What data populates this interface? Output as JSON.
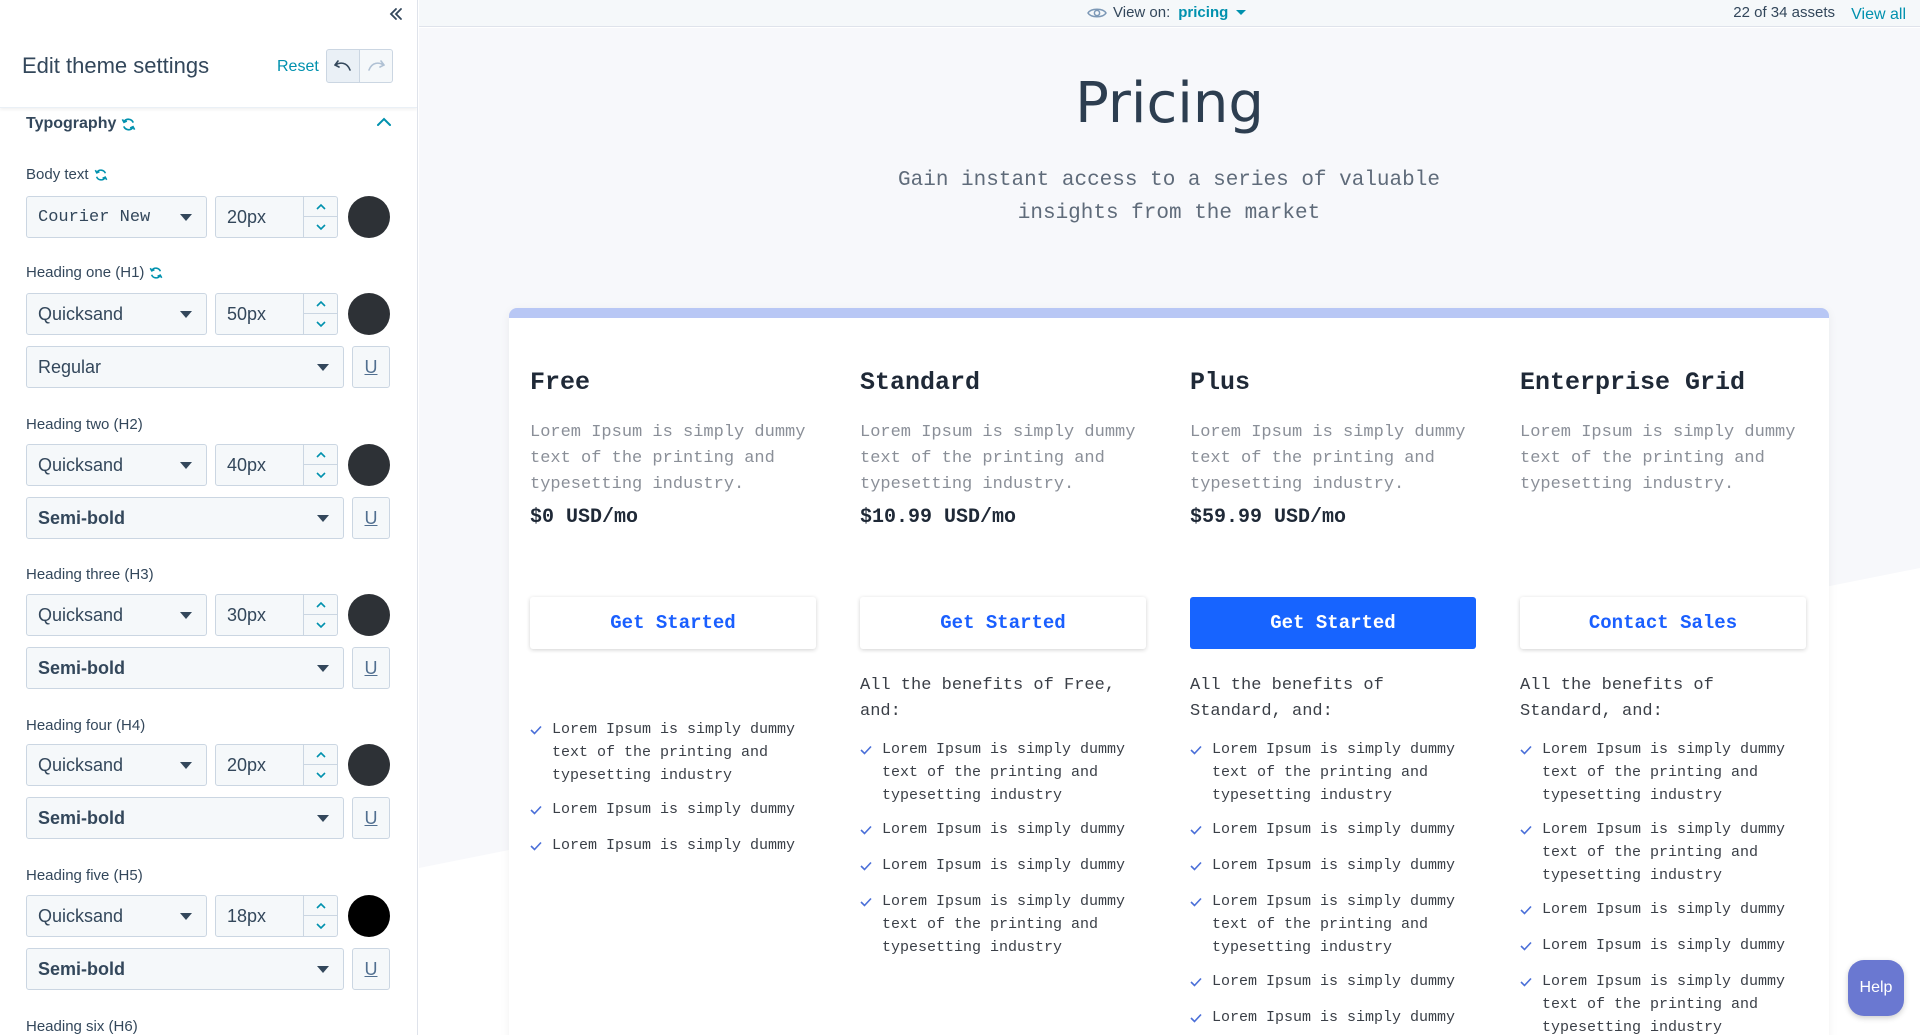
{
  "sidebar": {
    "title": "Edit theme settings",
    "reset_label": "Reset",
    "section": {
      "title": "Typography"
    },
    "groups": [
      {
        "label": "Body text",
        "sync": true,
        "font": "Courier New",
        "size": "20px",
        "color": "#2d3136"
      },
      {
        "label": "Heading one (H1)",
        "sync": true,
        "font": "Quicksand",
        "size": "50px",
        "color": "#2d3136",
        "weight": "Regular"
      },
      {
        "label": "Heading two (H2)",
        "sync": false,
        "font": "Quicksand",
        "size": "40px",
        "color": "#2d3136",
        "weight": "Semi-bold"
      },
      {
        "label": "Heading three (H3)",
        "sync": false,
        "font": "Quicksand",
        "size": "30px",
        "color": "#2d3136",
        "weight": "Semi-bold"
      },
      {
        "label": "Heading four (H4)",
        "sync": false,
        "font": "Quicksand",
        "size": "20px",
        "color": "#2d3136",
        "weight": "Semi-bold"
      },
      {
        "label": "Heading five (H5)",
        "sync": false,
        "font": "Quicksand",
        "size": "18px",
        "color": "#000000",
        "weight": "Semi-bold"
      },
      {
        "label": "Heading six (H6)"
      }
    ],
    "underline_glyph": "U"
  },
  "topbar": {
    "view_on_label": "View on:",
    "view_on_value": "pricing",
    "assets_count": "22 of 34 assets",
    "view_all": "View all"
  },
  "preview": {
    "title": "Pricing",
    "subtitle": "Gain instant access to a series of valuable insights from the market",
    "plans": [
      {
        "name": "Free",
        "description": "Lorem Ipsum is simply dummy text of the printing and typesetting industry.",
        "price": "$0 USD/mo",
        "cta": "Get Started",
        "primary": false,
        "intro": "",
        "features": [
          "Lorem Ipsum is simply dummy text of the printing and typesetting industry",
          "Lorem Ipsum is simply dummy",
          "Lorem Ipsum is simply dummy"
        ]
      },
      {
        "name": "Standard",
        "description": "Lorem Ipsum is simply dummy text of the printing and typesetting industry.",
        "price": "$10.99 USD/mo",
        "cta": "Get Started",
        "primary": false,
        "intro": "All the benefits of Free, and:",
        "features": [
          "Lorem Ipsum is simply dummy text of the printing and typesetting industry",
          "Lorem Ipsum is simply dummy",
          "Lorem Ipsum is simply dummy",
          "Lorem Ipsum is simply dummy text of the printing and typesetting industry"
        ]
      },
      {
        "name": "Plus",
        "description": "Lorem Ipsum is simply dummy text of the printing and typesetting industry.",
        "price": "$59.99 USD/mo",
        "cta": "Get Started",
        "primary": true,
        "intro": "All the benefits of Standard, and:",
        "features": [
          "Lorem Ipsum is simply dummy text of the printing and typesetting industry",
          "Lorem Ipsum is simply dummy",
          "Lorem Ipsum is simply dummy",
          "Lorem Ipsum is simply dummy text of the printing and typesetting industry",
          "Lorem Ipsum is simply dummy",
          "Lorem Ipsum is simply dummy"
        ]
      },
      {
        "name": "Enterprise Grid",
        "description": "Lorem Ipsum is simply dummy text of the printing and typesetting industry.",
        "price": "",
        "cta": "Contact Sales",
        "primary": false,
        "intro": "All the benefits of Standard, and:",
        "features": [
          "Lorem Ipsum is simply dummy text of the printing and typesetting industry",
          "Lorem Ipsum is simply dummy text of the printing and typesetting industry",
          "Lorem Ipsum is simply dummy",
          "Lorem Ipsum is simply dummy",
          "Lorem Ipsum is simply dummy text of the printing and typesetting industry"
        ]
      }
    ]
  },
  "help": {
    "label": "Help"
  },
  "colors": {
    "accent": "#0091ae",
    "primary_button": "#1764ff",
    "check": "#4a6fd8"
  }
}
